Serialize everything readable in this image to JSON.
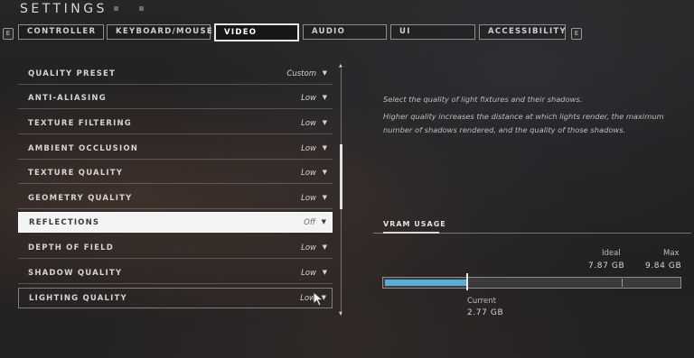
{
  "header": {
    "title": "SETTINGS"
  },
  "tabs": {
    "left_bumper": "E",
    "right_bumper": "E",
    "items": [
      {
        "label": "CONTROLLER",
        "active": false
      },
      {
        "label": "KEYBOARD/MOUSE",
        "active": false
      },
      {
        "label": "VIDEO",
        "active": true
      },
      {
        "label": "AUDIO",
        "active": false
      },
      {
        "label": "UI",
        "active": false
      },
      {
        "label": "ACCESSIBILITY",
        "active": false
      }
    ]
  },
  "settings": [
    {
      "label": "QUALITY PRESET",
      "value": "Custom"
    },
    {
      "label": "ANTI-ALIASING",
      "value": "Low"
    },
    {
      "label": "TEXTURE FILTERING",
      "value": "Low"
    },
    {
      "label": "AMBIENT OCCLUSION",
      "value": "Low"
    },
    {
      "label": "TEXTURE QUALITY",
      "value": "Low"
    },
    {
      "label": "GEOMETRY QUALITY",
      "value": "Low"
    },
    {
      "label": "REFLECTIONS",
      "value": "Off",
      "selected": true
    },
    {
      "label": "DEPTH OF FIELD",
      "value": "Low"
    },
    {
      "label": "SHADOW QUALITY",
      "value": "Low"
    },
    {
      "label": "LIGHTING QUALITY",
      "value": "Low",
      "hovered": true
    }
  ],
  "description": {
    "line1": "Select the quality of light fixtures and their shadows.",
    "line2": "Higher quality increases the distance at which lights render, the maximum",
    "line3": "number of shadows rendered, and the quality of those shadows."
  },
  "vram": {
    "title": "VRAM USAGE",
    "ideal_label": "Ideal",
    "ideal_value": "7.87 GB",
    "max_label": "Max",
    "max_value": "9.84 GB",
    "current_label": "Current",
    "current_value": "2.77 GB",
    "current_fraction": 0.28,
    "ideal_fraction": 0.8
  },
  "colors": {
    "vram_fill": "#59acd2",
    "selected_row": "#f3f3f3"
  }
}
